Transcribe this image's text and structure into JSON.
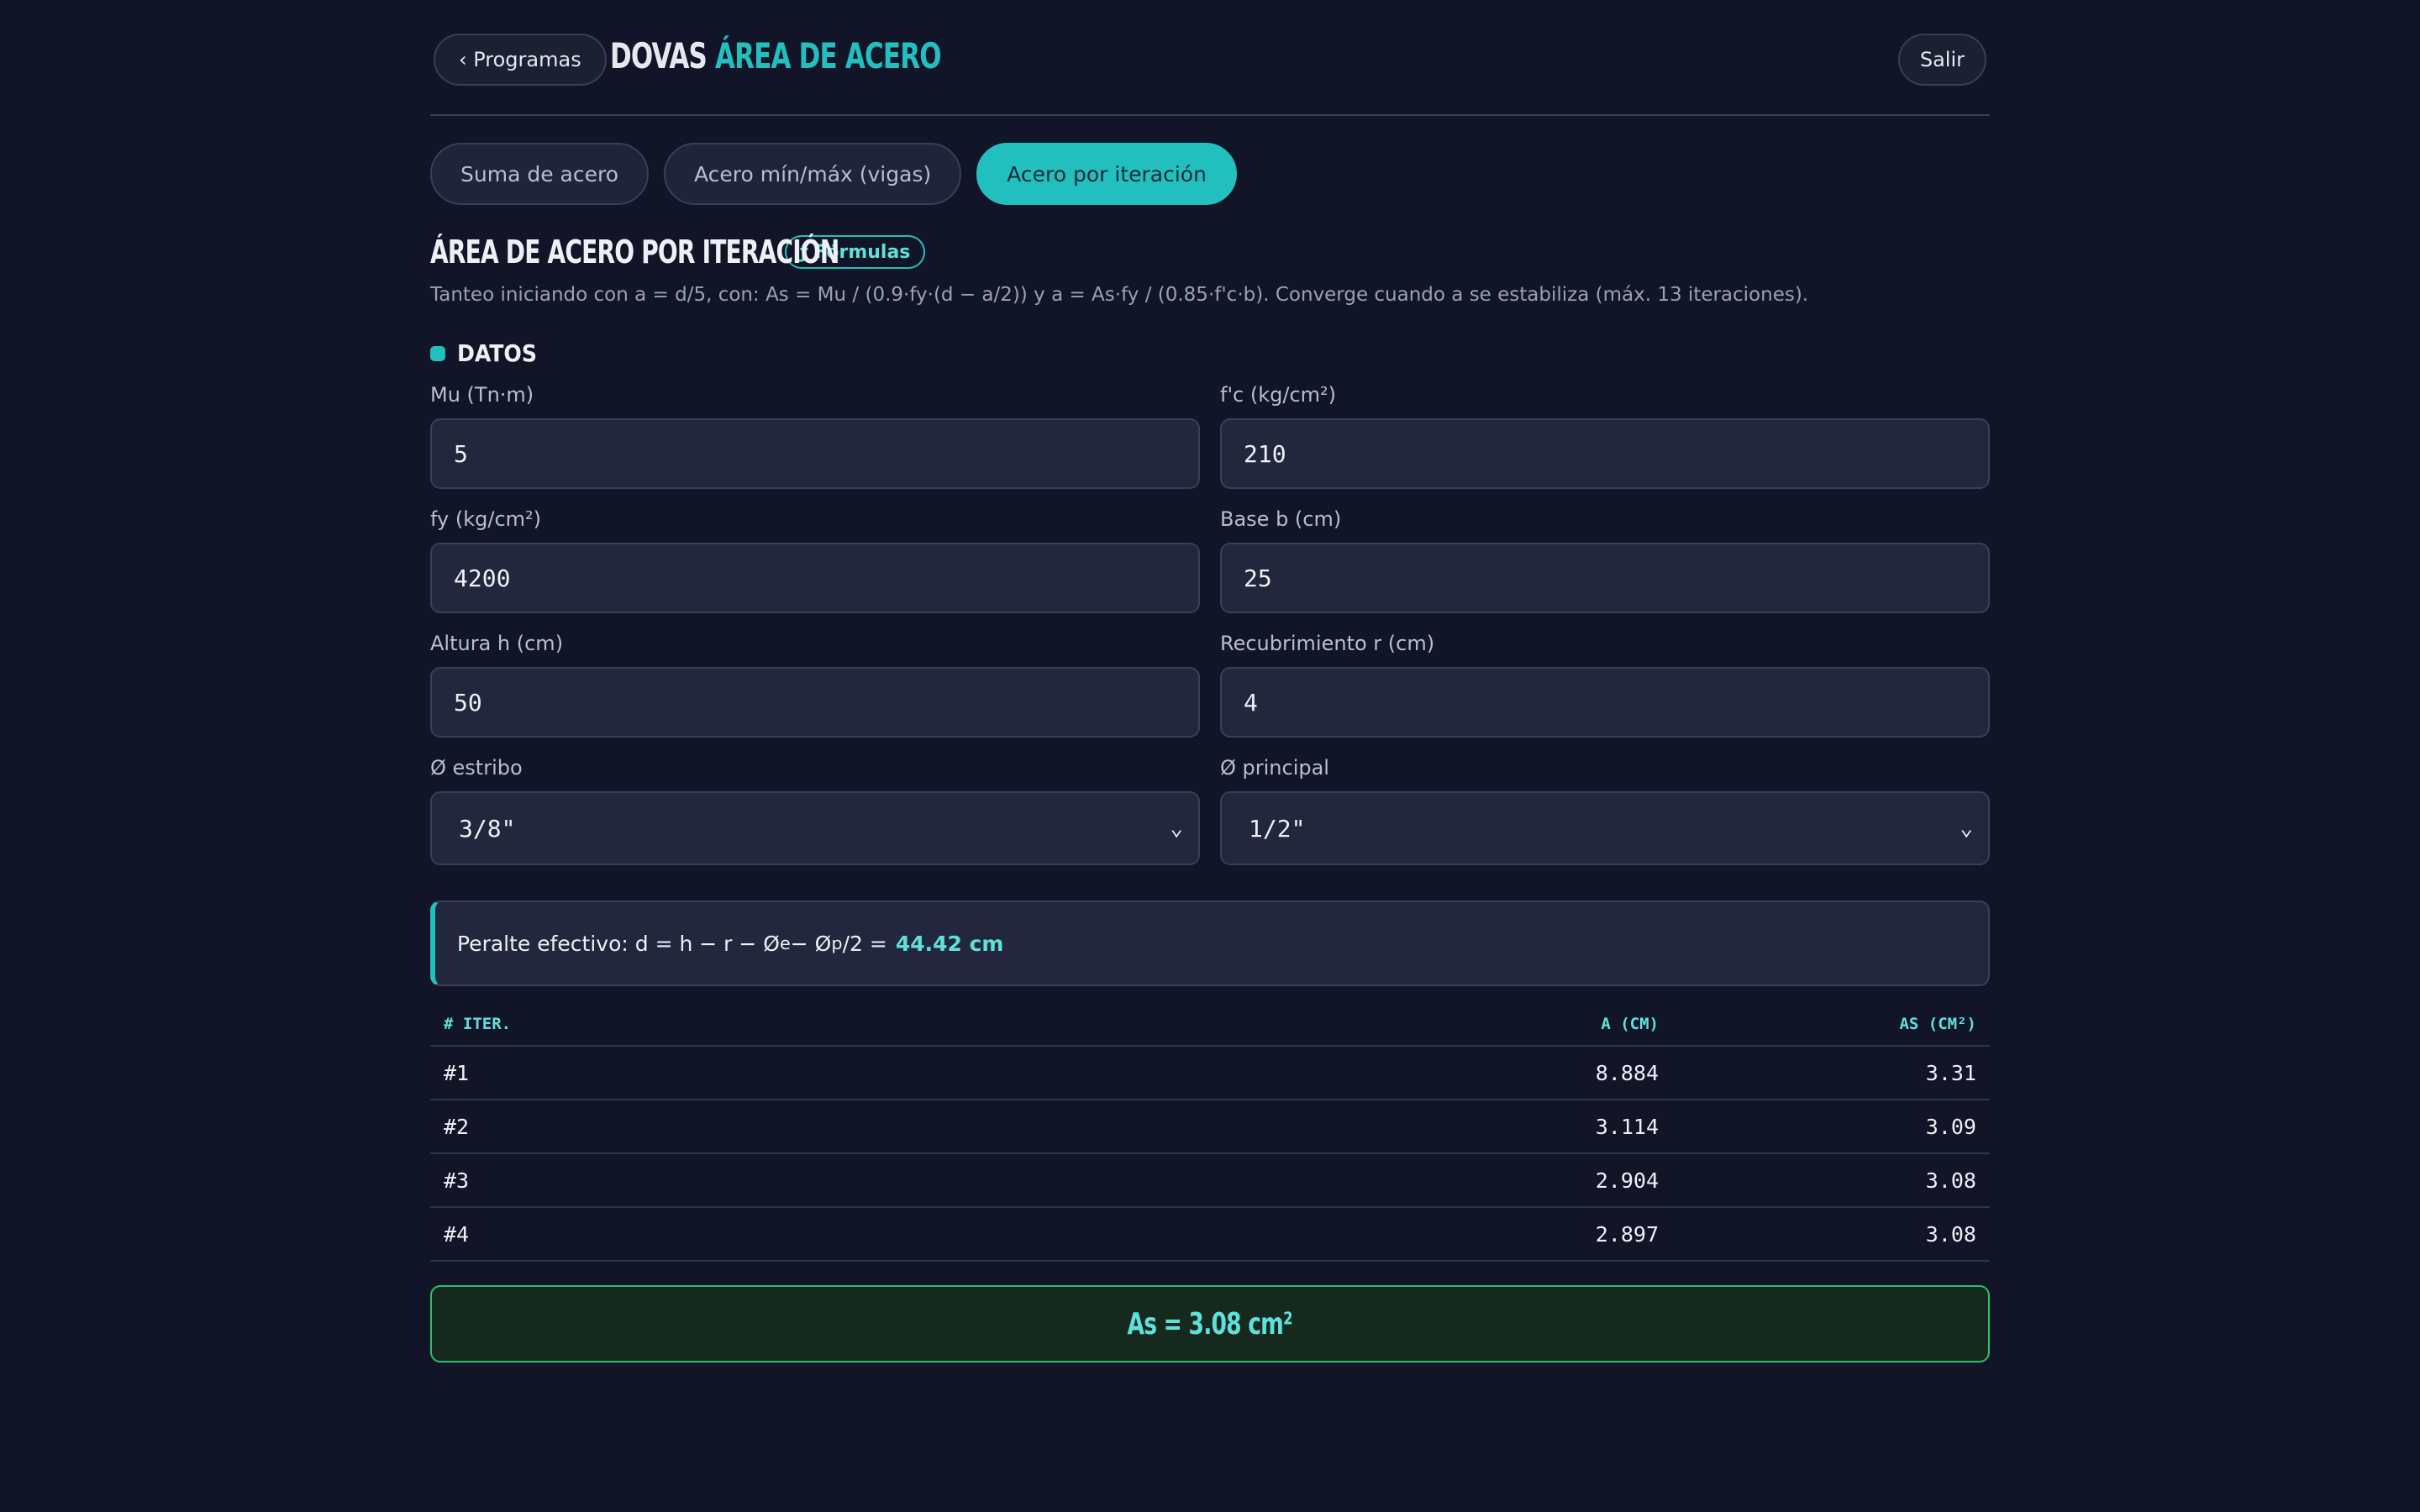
{
  "header": {
    "back_label": "‹ Programas",
    "brand_main": "DOVAS",
    "brand_accent": "ÁREA DE ACERO",
    "logout_label": "Salir"
  },
  "tabs": [
    {
      "label": "Suma de acero",
      "active": false
    },
    {
      "label": "Acero mín/máx (vigas)",
      "active": false
    },
    {
      "label": "Acero por iteración",
      "active": true
    }
  ],
  "section": {
    "title": "ÁREA DE ACERO POR ITERACIÓN",
    "formulas_badge": "ƒ Fórmulas",
    "description": "Tanteo iniciando con a = d/5, con: As = Mu / (0.9·fy·(d − a/2))  y  a = As·fy / (0.85·f'c·b). Converge cuando a se estabiliza (máx. 13 iteraciones)."
  },
  "datos_label": "DATOS",
  "fields": {
    "mu": {
      "label": "Mu (Tn·m)",
      "value": "5"
    },
    "fc": {
      "label": "f'c (kg/cm²)",
      "value": "210"
    },
    "fy": {
      "label": "fy (kg/cm²)",
      "value": "4200"
    },
    "b": {
      "label": "Base b (cm)",
      "value": "25"
    },
    "h": {
      "label": "Altura h (cm)",
      "value": "50"
    },
    "r": {
      "label": "Recubrimiento r (cm)",
      "value": "4"
    },
    "estribo": {
      "label": "Ø estribo",
      "value": "3/8\""
    },
    "principal": {
      "label": "Ø principal",
      "value": "1/2\""
    }
  },
  "peralte": {
    "prefix": "Peralte efectivo: d = h − r − Ø",
    "sub_e": "e",
    "mid": " − Ø",
    "sub_p": "p",
    "suffix": "/2 =",
    "value": "44.42 cm"
  },
  "table": {
    "headers": [
      "# ITER.",
      "A (CM)",
      "AS (CM²)"
    ],
    "rows": [
      [
        "#1",
        "8.884",
        "3.31"
      ],
      [
        "#2",
        "3.114",
        "3.09"
      ],
      [
        "#3",
        "2.904",
        "3.08"
      ],
      [
        "#4",
        "2.897",
        "3.08"
      ]
    ]
  },
  "result": "As = 3.08 cm²"
}
